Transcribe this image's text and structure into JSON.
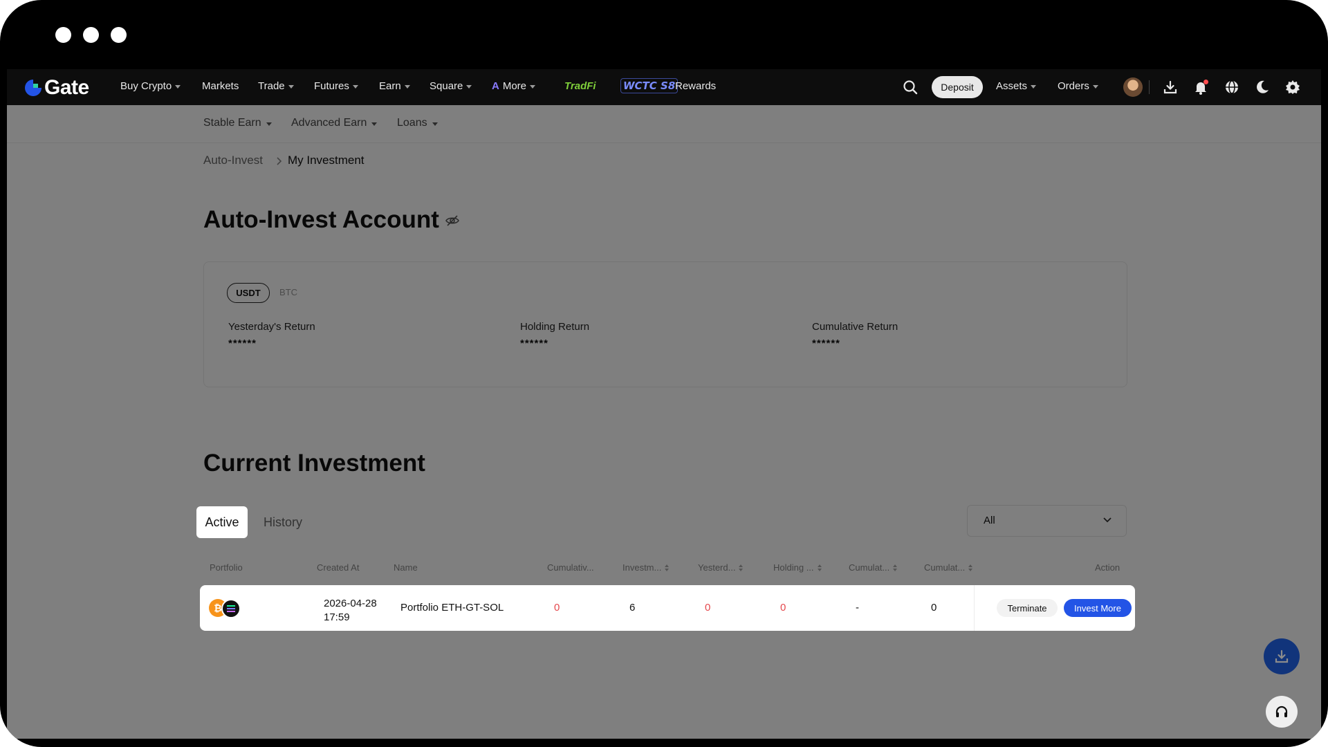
{
  "brand": {
    "name": "Gate",
    "accent": "#2354e6"
  },
  "nav": {
    "items": [
      {
        "label": "Buy Crypto",
        "caret": true
      },
      {
        "label": "Markets",
        "caret": false
      },
      {
        "label": "Trade",
        "caret": true
      },
      {
        "label": "Futures",
        "caret": true
      },
      {
        "label": "Earn",
        "caret": true
      },
      {
        "label": "Square",
        "caret": true
      },
      {
        "label": "More",
        "caret": true
      },
      {
        "label": "TradFi",
        "caret": false
      },
      {
        "label": "WCTC S8",
        "caret": false
      },
      {
        "label": "Rewards",
        "caret": false
      }
    ],
    "deposit": "Deposit",
    "assets": "Assets",
    "orders": "Orders"
  },
  "subnav": {
    "items": [
      {
        "label": "Stable Earn"
      },
      {
        "label": "Advanced Earn"
      },
      {
        "label": "Loans"
      }
    ]
  },
  "breadcrumb": {
    "parent": "Auto-Invest",
    "current": "My Investment"
  },
  "account": {
    "title": "Auto-Invest Account",
    "currencies": [
      "USDT",
      "BTC"
    ],
    "metrics": [
      {
        "label": "Yesterday's Return",
        "value": "******"
      },
      {
        "label": "Holding Return",
        "value": "******"
      },
      {
        "label": "Cumulative Return",
        "value": "******"
      }
    ]
  },
  "current": {
    "title": "Current Investment",
    "tabs": [
      "Active",
      "History"
    ],
    "filter": "All",
    "columns": [
      "Portfolio",
      "Created At",
      "Name",
      "Cumulativ...",
      "Investm...",
      "Yesterd...",
      "Holding ...",
      "Cumulat...",
      "Cumulat...",
      "Action"
    ],
    "rows": [
      {
        "created_date": "2026-04-28",
        "created_time": "17:59",
        "name": "Portfolio ETH-GT-SOL",
        "cumulative": "0",
        "investment": "6",
        "yesterday": "0",
        "holding": "0",
        "cumulative2": "-",
        "cumulative3": "0",
        "terminate": "Terminate",
        "invest_more": "Invest More"
      }
    ]
  }
}
